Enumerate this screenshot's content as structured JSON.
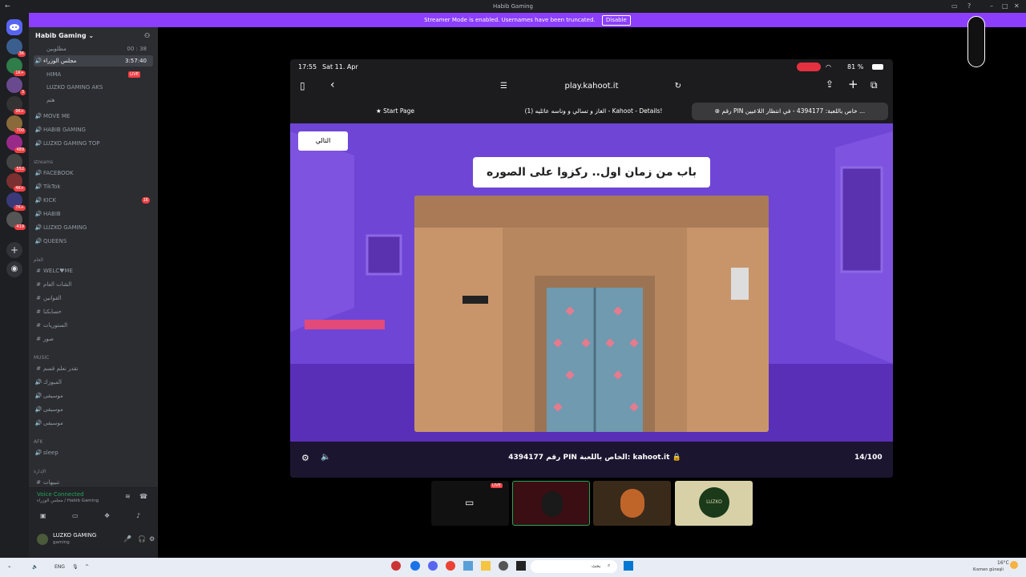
{
  "window": {
    "title": "Habib Gaming"
  },
  "banner": {
    "text": "Streamer Mode is enabled. Usernames have been truncated.",
    "disable": "Disable"
  },
  "guild_badges": [
    "36",
    "1K+",
    "3",
    "9K+",
    "700",
    "489",
    "552",
    "4K+",
    "7K+",
    "419"
  ],
  "server": {
    "name": "Habib Gaming"
  },
  "channels": {
    "user1": "مطلوبين",
    "user1_count": "00 : 38",
    "vc_active": "مجلس الوزراء",
    "vc_active_time": "3:57:40",
    "member1": "HIMA",
    "member1_live": "LIVE",
    "member2": "LUZKO GAMING",
    "member2_tag": "AKS",
    "member3": "هتم",
    "move": "MOVE ME",
    "habib_gaming": "HABIB GAMING",
    "luzko_top": "LUZKO GAMING TOP",
    "cat_streams": "streams",
    "facebook": "FACEBOOK",
    "tiktok": "TikTok",
    "kick": "KICK",
    "kick_badge": "16",
    "habib": "HABIB",
    "luzko": "LUZKO GAMING",
    "queens": "QUEENS",
    "cat_main": "العام",
    "welcome": "WELC♥ME",
    "rules1": "الشات العام",
    "rules2": "القوانين",
    "rules3": "حسابكنا",
    "rules4": "الستوريات",
    "rules5": "صور",
    "cat_music": "MUSIC",
    "music1": "نقدر نعلم قسم",
    "music2": "الميوزك",
    "music3": "موسيقى",
    "music4": "موسيقى",
    "music5": "موسيقى",
    "cat_afk": "AFK",
    "afk": "sleep",
    "cat_admin": "الإدارة",
    "admin1": "تنبيهات"
  },
  "voice": {
    "status": "Voice Connected",
    "location": "مجلس الوزراء / Habib Gaming"
  },
  "user": {
    "name": "LUZKO GAMING",
    "status": "gaming"
  },
  "ipad": {
    "time": "17:55",
    "date": "Sat 11. Apr",
    "battery": "81 %",
    "url": "play.kahoot.it",
    "tabs": [
      "Start Page",
      "الغاز و تسالي و وناسه عائليه (1) - Kahoot - Details!",
      "رقم PIN خاص باللعبة: 4394177 - في انتظار اللاعبين ..."
    ]
  },
  "game": {
    "next": "التالي",
    "question": "باب من زمان اول.. ركزوا على الصوره",
    "pin_label": "رقم PIN الخاص باللعبة:",
    "pin": "4394177",
    "site": "kahoot.it",
    "progress": "14/100"
  },
  "tiles": {
    "live": "LIVE",
    "logo_text": "LUZKO"
  },
  "taskbar": {
    "lang": "ENG",
    "search": "بحث",
    "weather": "16°C",
    "weather_desc": "Kısmen güneşli",
    "time": "٥:٥٥",
    "date": "٤/١١/٢٦"
  },
  "colors": {
    "discord_bg": "#1e1f22",
    "sidebar": "#2b2d31",
    "banner": "#8b3ffc",
    "kahoot_purple": "#6b3fcf",
    "live_red": "#f23f43"
  }
}
